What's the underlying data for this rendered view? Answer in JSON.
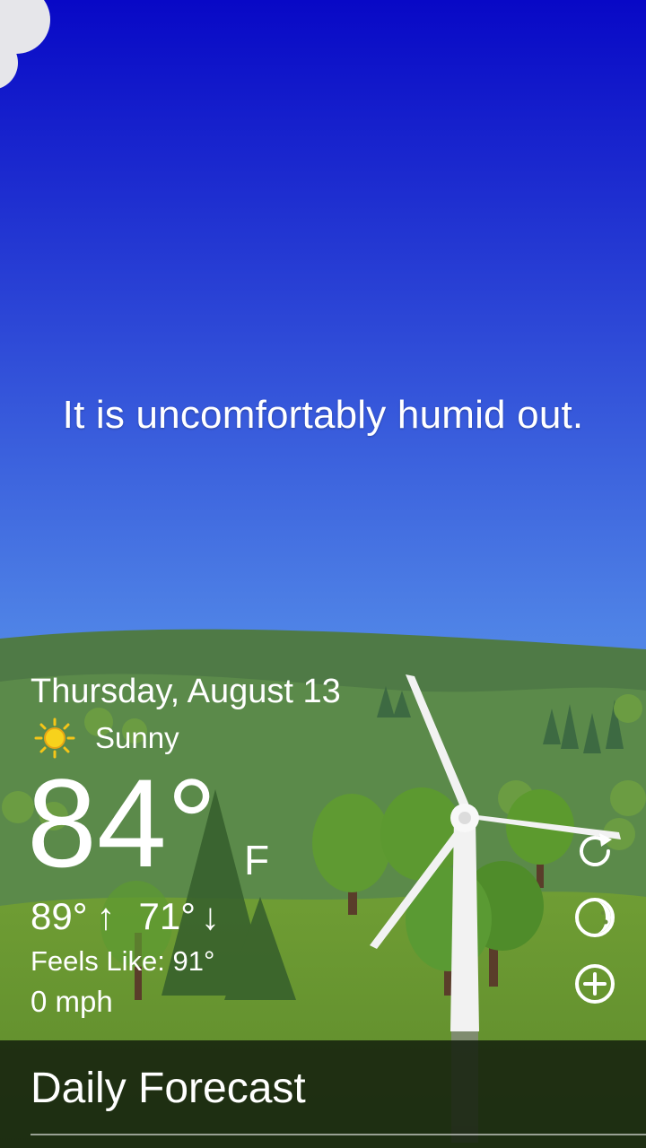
{
  "message": "It is uncomfortably humid out.",
  "date": "Thursday, August 13",
  "condition": {
    "label": "Sunny",
    "icon": "sun-icon"
  },
  "temperature": {
    "value": "84°",
    "unit": "F"
  },
  "high_low": {
    "high": "89°",
    "high_arrow": "↑",
    "low": "71°",
    "low_arrow": "↓"
  },
  "feels_like": "Feels Like: 91°",
  "wind": "0 mph",
  "actions": [
    {
      "icon": "refresh-icon"
    },
    {
      "icon": "moon-icon"
    },
    {
      "icon": "add-icon"
    }
  ],
  "footer": {
    "title": "Daily Forecast"
  },
  "colors": {
    "sky_top": "#0808c6",
    "sky_bottom": "#6fa3ef",
    "hill": "#4e7a44",
    "grass": "#68952f",
    "sun": "#f5c518"
  }
}
